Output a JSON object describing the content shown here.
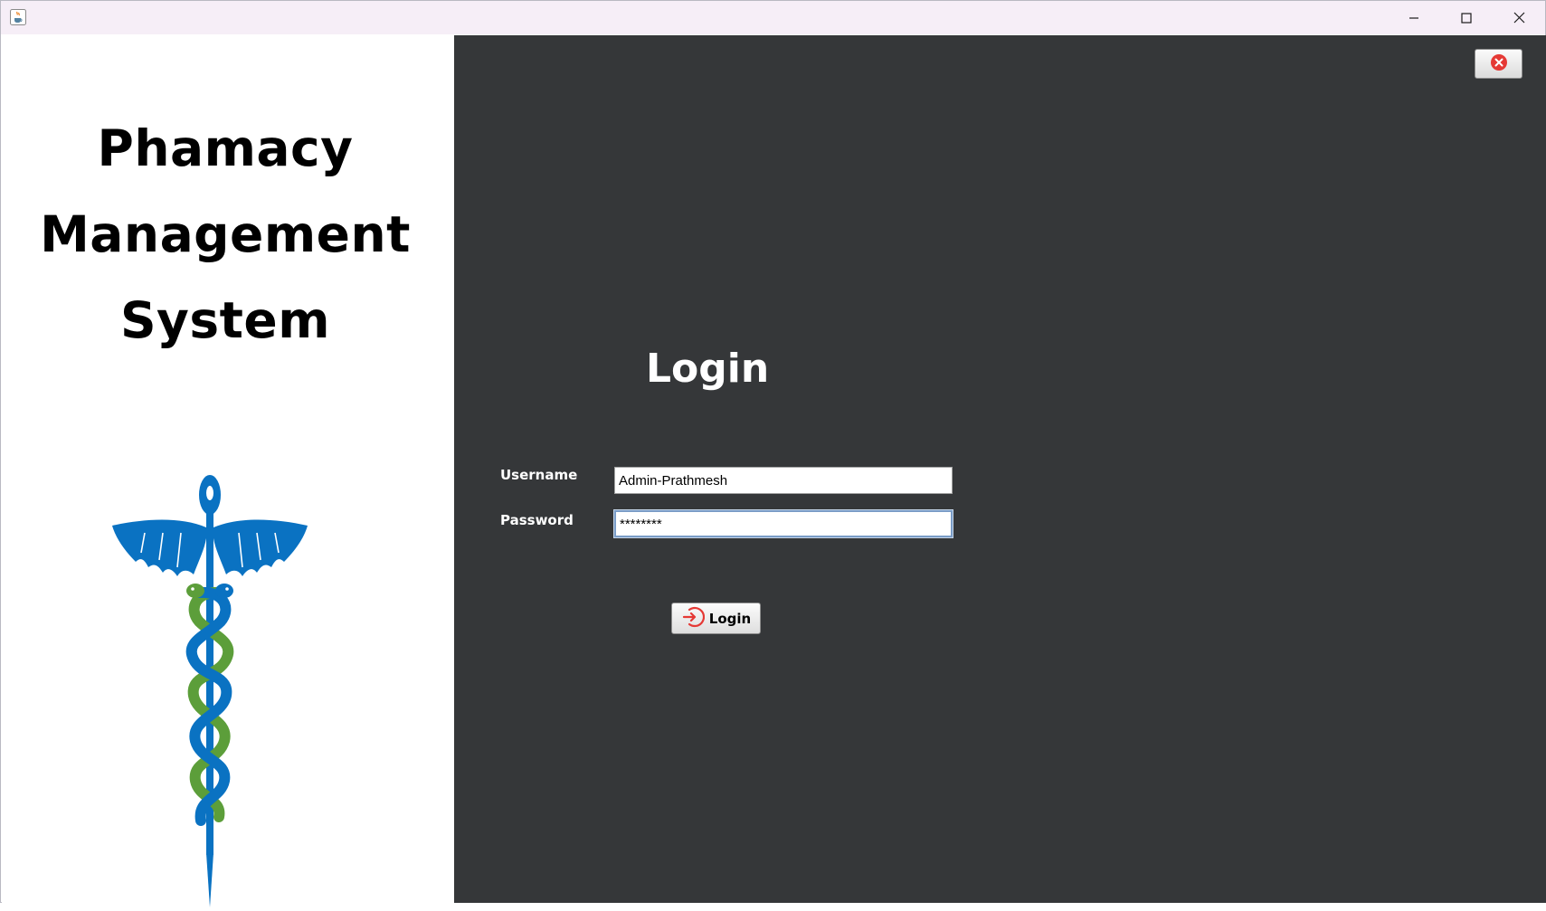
{
  "window": {
    "app_icon": "java-cup-icon",
    "controls": {
      "minimize": "minimize-icon",
      "maximize": "maximize-icon",
      "close": "close-icon"
    }
  },
  "brand": {
    "title_lines": [
      "Phamacy",
      "Management",
      "System"
    ],
    "logo": "caduceus-icon"
  },
  "login": {
    "heading": "Login",
    "username_label": "Username",
    "username_value": "Admin-Prathmesh",
    "password_label": "Password",
    "password_value": "********",
    "submit_label": "Login",
    "submit_icon": "login-arrow-icon",
    "close_app_icon": "red-close-icon"
  },
  "colors": {
    "panel_dark": "#353739",
    "titlebar": "#f6eef7",
    "logo_blue": "#0a72c2",
    "logo_green": "#5c9e3a",
    "accent_red": "#e53935"
  }
}
